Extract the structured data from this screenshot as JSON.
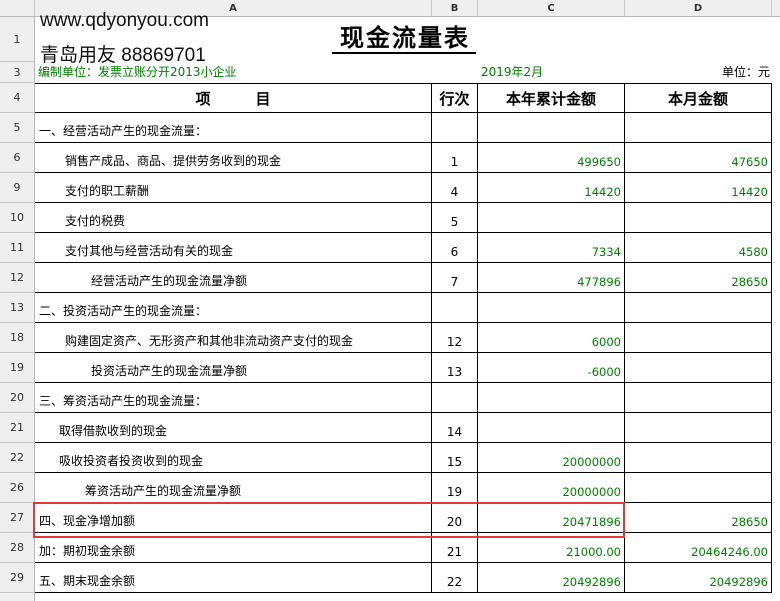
{
  "watermark": {
    "line1": "www.qdyonyou.com",
    "line2": "青岛用友 88869701"
  },
  "column_headers": [
    "A",
    "B",
    "C",
    "D"
  ],
  "title": "现金流量表",
  "info": {
    "company": "编制单位：发票立账分开2013小企业",
    "period": "2019年2月",
    "unit": "单位：元"
  },
  "table_headers": {
    "item": "项　　　目",
    "line_no": "行次",
    "ytd": "本年累计金额",
    "month": "本月金额"
  },
  "row_numbers": {
    "r1": "1",
    "r3": "3",
    "r4": "4",
    "r5": "5",
    "r6": "6",
    "r9": "9",
    "r10": "10",
    "r11": "11",
    "r12": "12",
    "r13": "13",
    "r18": "18",
    "r19": "19",
    "r20": "20",
    "r21": "21",
    "r22": "22",
    "r26": "26",
    "r27": "27",
    "r28": "28",
    "r29": "29"
  },
  "rows": [
    {
      "item": "一、经营活动产生的现金流量：",
      "line": "",
      "ytd": "",
      "month": ""
    },
    {
      "item": "销售产成品、商品、提供劳务收到的现金",
      "line": "1",
      "ytd": "499650",
      "month": "47650"
    },
    {
      "item": "支付的职工薪酬",
      "line": "4",
      "ytd": "14420",
      "month": "14420"
    },
    {
      "item": "支付的税费",
      "line": "5",
      "ytd": "",
      "month": ""
    },
    {
      "item": "支付其他与经营活动有关的现金",
      "line": "6",
      "ytd": "7334",
      "month": "4580"
    },
    {
      "item": "经营活动产生的现金流量净额",
      "line": "7",
      "ytd": "477896",
      "month": "28650"
    },
    {
      "item": "二、投资活动产生的现金流量：",
      "line": "",
      "ytd": "",
      "month": ""
    },
    {
      "item": "购建固定资产、无形资产和其他非流动资产支付的现金",
      "line": "12",
      "ytd": "6000",
      "month": ""
    },
    {
      "item": "投资活动产生的现金流量净额",
      "line": "13",
      "ytd": "-6000",
      "month": ""
    },
    {
      "item": "三、筹资活动产生的现金流量：",
      "line": "",
      "ytd": "",
      "month": ""
    },
    {
      "item": "取得借款收到的现金",
      "line": "14",
      "ytd": "",
      "month": ""
    },
    {
      "item": "吸收投资者投资收到的现金",
      "line": "15",
      "ytd": "20000000",
      "month": ""
    },
    {
      "item": "筹资活动产生的现金流量净额",
      "line": "19",
      "ytd": "20000000",
      "month": ""
    },
    {
      "item": "四、现金净增加额",
      "line": "20",
      "ytd": "20471896",
      "month": "28650"
    },
    {
      "item": "加：期初现金余额",
      "line": "21",
      "ytd": "21000.00",
      "month": "20464246.00"
    },
    {
      "item": "五、期末现金余额",
      "line": "22",
      "ytd": "20492896",
      "month": "20492896"
    }
  ]
}
